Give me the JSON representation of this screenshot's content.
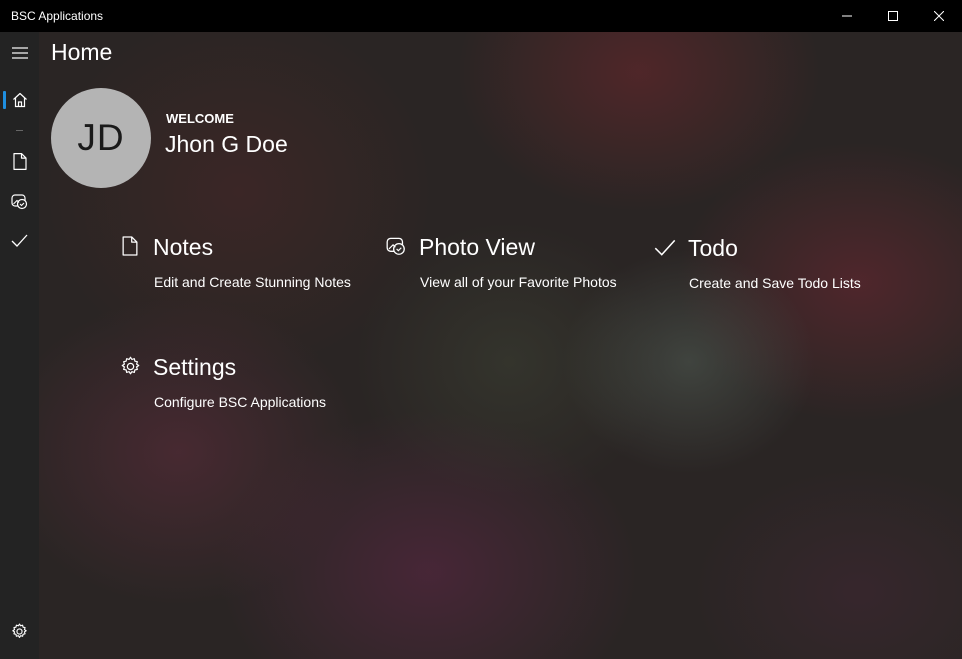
{
  "window": {
    "title": "BSC Applications",
    "controls": [
      "minimize-icon",
      "maximize-icon",
      "close-icon"
    ]
  },
  "sidebar": {
    "items": [
      {
        "name": "hamburger-menu",
        "icon": "hamburger-icon"
      },
      {
        "name": "home",
        "icon": "home-icon",
        "selected": true
      },
      {
        "name": "notes",
        "icon": "document-icon"
      },
      {
        "name": "photo-view",
        "icon": "photo-icon"
      },
      {
        "name": "todo",
        "icon": "checkmark-icon"
      },
      {
        "name": "settings",
        "icon": "gear-icon"
      }
    ],
    "accent_color": "#1f8fe0"
  },
  "main": {
    "page_title": "Home",
    "avatar_initials": "JD",
    "welcome_label": "WELCOME",
    "user_name": "Jhon G Doe",
    "tiles": [
      {
        "title": "Notes",
        "description": "Edit and Create Stunning Notes",
        "icon": "document-icon"
      },
      {
        "title": "Photo View",
        "description": "View all of your Favorite Photos",
        "icon": "photo-icon"
      },
      {
        "title": "Todo",
        "description": "Create and Save Todo Lists",
        "icon": "checkmark-icon"
      },
      {
        "title": "Settings",
        "description": "Configure BSC Applications",
        "icon": "gear-icon"
      }
    ]
  }
}
